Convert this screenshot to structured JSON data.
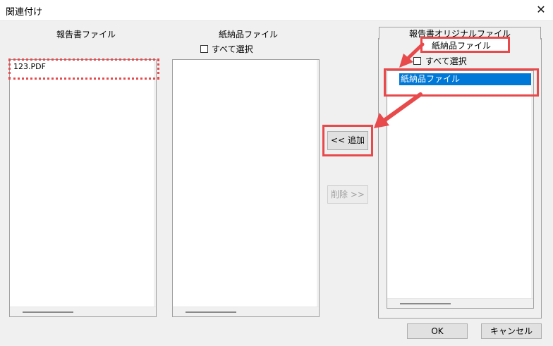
{
  "window": {
    "title": "関連付け",
    "close_glyph": "✕"
  },
  "report_panel": {
    "header": "報告書ファイル",
    "items": [
      "123.PDF"
    ]
  },
  "paper_panel": {
    "header": "紙納品ファイル",
    "select_all_label": "すべて選択"
  },
  "original_panel": {
    "tab_label": "報告書オリジナルファイル",
    "subheader": "紙納品ファイル",
    "select_all_label": "すべて選択",
    "items": [
      "紙納品ファイル"
    ]
  },
  "buttons": {
    "add": "<< 追加",
    "remove": "削除 >>",
    "ok": "OK",
    "cancel": "キャンセル"
  },
  "colors": {
    "annotation_red": "#e8494b",
    "selection_blue": "#0078d7"
  }
}
